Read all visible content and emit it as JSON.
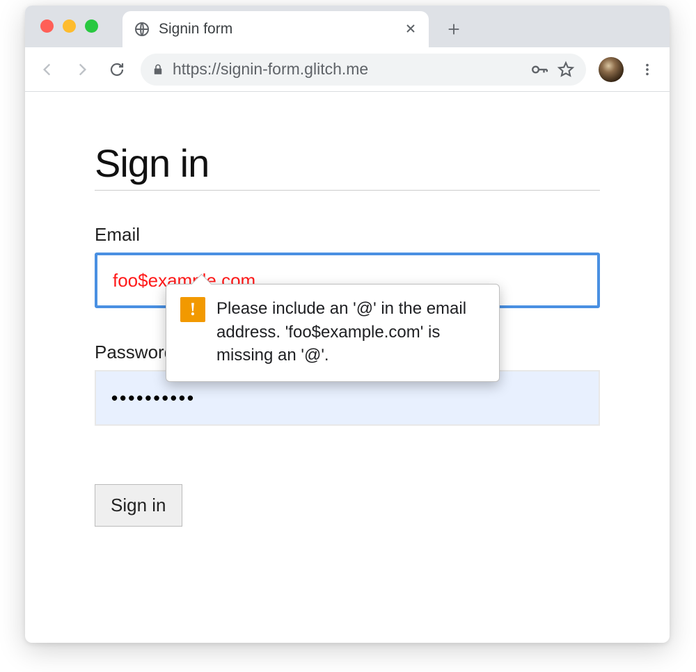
{
  "browser": {
    "tab_title": "Signin form",
    "url": "https://signin-form.glitch.me"
  },
  "page": {
    "heading": "Sign in",
    "email_label": "Email",
    "email_value": "foo$example.com",
    "password_label": "Password",
    "password_value": "••••••••••",
    "submit_label": "Sign in",
    "validation_message": "Please include an '@' in the email address. 'foo$example.com' is missing an '@'."
  }
}
